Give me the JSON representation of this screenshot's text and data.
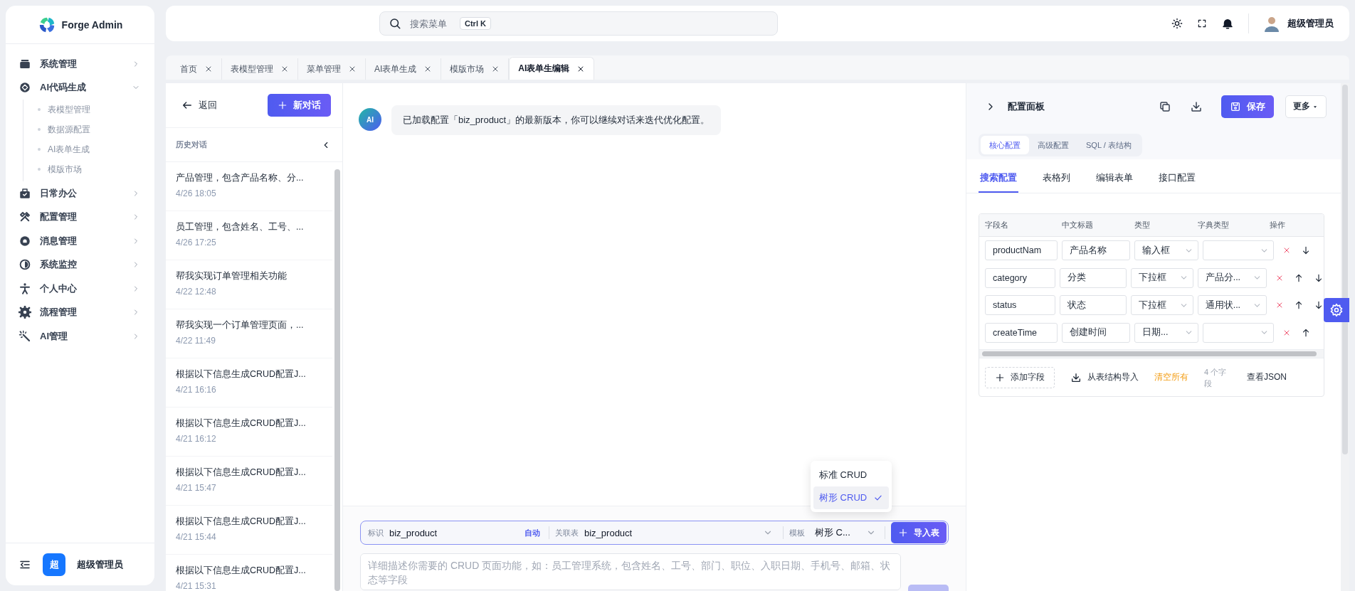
{
  "app": {
    "name": "Forge Admin"
  },
  "sidebar": {
    "items": [
      {
        "label": "系统管理",
        "expanded": false,
        "selected": false
      },
      {
        "label": "AI代码生成",
        "expanded": true,
        "selected": false,
        "children": [
          {
            "label": "表模型管理",
            "selected": false
          },
          {
            "label": "数据源配置",
            "selected": false
          },
          {
            "label": "AI表单生成",
            "selected": false
          },
          {
            "label": "模版市场",
            "selected": false
          }
        ]
      },
      {
        "label": "日常办公",
        "expanded": false,
        "selected": false
      },
      {
        "label": "配置管理",
        "expanded": false,
        "selected": false
      },
      {
        "label": "消息管理",
        "expanded": false,
        "selected": false
      },
      {
        "label": "系统监控",
        "expanded": false,
        "selected": false
      },
      {
        "label": "个人中心",
        "expanded": false,
        "selected": false
      },
      {
        "label": "流程管理",
        "expanded": false,
        "selected": false
      },
      {
        "label": "AI管理",
        "expanded": false,
        "selected": false
      }
    ],
    "footer": {
      "avatar_text": "超",
      "user": "超级管理员"
    }
  },
  "topbar": {
    "search": {
      "placeholder": "搜索菜单",
      "shortcut": "Ctrl K"
    },
    "user": "超级管理员"
  },
  "tabs": [
    {
      "label": "首页",
      "selected": false
    },
    {
      "label": "表模型管理",
      "selected": false
    },
    {
      "label": "菜单管理",
      "selected": false
    },
    {
      "label": "AI表单生成",
      "selected": false
    },
    {
      "label": "模版市场",
      "selected": false
    },
    {
      "label": "AI表单生编辑",
      "selected": true
    }
  ],
  "history": {
    "back": "返回",
    "new_chat": "新对话",
    "title": "历史对话",
    "items": [
      {
        "title": "产品管理，包含产品名称、分...",
        "time": "4/26 18:05"
      },
      {
        "title": "员工管理，包含姓名、工号、...",
        "time": "4/26 17:25"
      },
      {
        "title": "帮我实现订单管理相关功能",
        "time": "4/22 12:48"
      },
      {
        "title": "帮我实现一个订单管理页面，...",
        "time": "4/22 11:49"
      },
      {
        "title": "根据以下信息生成CRUD配置J...",
        "time": "4/21 16:16"
      },
      {
        "title": "根据以下信息生成CRUD配置J...",
        "time": "4/21 16:12"
      },
      {
        "title": "根据以下信息生成CRUD配置J...",
        "time": "4/21 15:47"
      },
      {
        "title": "根据以下信息生成CRUD配置J...",
        "time": "4/21 15:44"
      },
      {
        "title": "根据以下信息生成CRUD配置J...",
        "time": "4/21 15:31"
      }
    ]
  },
  "chat": {
    "messages": [
      {
        "avatar": "AI",
        "text": "已加载配置「biz_product」的最新版本，你可以继续对话来迭代优化配置。"
      }
    ],
    "composer": {
      "id_label": "标识",
      "id_value": "biz_product",
      "auto": "自动",
      "table_label": "关联表",
      "table_value": "biz_product",
      "template_label": "模板",
      "template_value": "树形 C...",
      "import": "导入表",
      "template_menu": [
        {
          "label": "标准 CRUD",
          "selected": false
        },
        {
          "label": "树形 CRUD",
          "selected": true
        }
      ],
      "placeholder": "详细描述你需要的 CRUD 页面功能，如：员工管理系统，包含姓名、工号、部门、职位、入职日期、手机号、邮箱、状态等字段"
    }
  },
  "config": {
    "title": "配置面板",
    "save": "保存",
    "more": "更多",
    "mode_tabs": [
      {
        "label": "核心配置",
        "selected": true
      },
      {
        "label": "高级配置",
        "selected": false
      },
      {
        "label": "SQL / 表结构",
        "selected": false
      }
    ],
    "tabs": [
      {
        "label": "搜索配置",
        "selected": true
      },
      {
        "label": "表格列",
        "selected": false
      },
      {
        "label": "编辑表单",
        "selected": false
      },
      {
        "label": "接口配置",
        "selected": false
      }
    ],
    "table": {
      "columns": [
        "字段名",
        "中文标题",
        "类型",
        "字典类型",
        "操作"
      ],
      "rows": [
        {
          "field": "productNam",
          "title": "产品名称",
          "type": "输入框",
          "up": false,
          "down": true
        },
        {
          "field": "category",
          "title": "分类",
          "type": "下拉框",
          "dict": "产品分...",
          "up": true,
          "down": true
        },
        {
          "field": "status",
          "title": "状态",
          "type": "下拉框",
          "dict": "通用状...",
          "up": true,
          "down": true
        },
        {
          "field": "createTime",
          "title": "创建时间",
          "type": "日期...",
          "up": true,
          "down": false
        }
      ]
    },
    "footer": {
      "add": "添加字段",
      "import": "从表结构导入",
      "clear": "清空所有",
      "count": "4 个字段",
      "json": "查看JSON"
    }
  }
}
